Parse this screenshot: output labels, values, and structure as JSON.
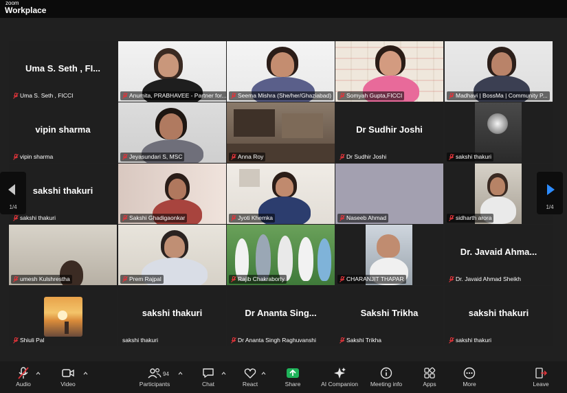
{
  "app": {
    "brand_small": "zoom",
    "brand_big": "Workplace"
  },
  "gallery": {
    "page_left": "1/4",
    "page_right": "1/4",
    "tiles": [
      {
        "big": "Uma S. Seth , FI...",
        "label": "Uma S. Seth , FICCI"
      },
      {
        "big": "",
        "label": "Anumita, PRABHAVEE - Partner for..."
      },
      {
        "big": "",
        "label": "Seema Mishra (She/her/Ghaziabad)"
      },
      {
        "big": "",
        "label": "Somyah Gupta,FICCI"
      },
      {
        "big": "",
        "label": "Madhavi | BossMa | Community P..."
      },
      {
        "big": "vipin sharma",
        "label": "vipin sharma"
      },
      {
        "big": "",
        "label": "Jeyasundari S, MSC"
      },
      {
        "big": "",
        "label": "Anna Roy"
      },
      {
        "big": "Dr Sudhir Joshi",
        "label": "Dr Sudhir Joshi"
      },
      {
        "big": "",
        "label": "sakshi thakuri"
      },
      {
        "big": "sakshi thakuri",
        "label": "sakshi thakuri"
      },
      {
        "big": "",
        "label": "Sakshi Ghadigaonkar"
      },
      {
        "big": "",
        "label": "Jyoti Khemka"
      },
      {
        "big": "",
        "label": "Naseeb Ahmad"
      },
      {
        "big": "",
        "label": "sidharth arora"
      },
      {
        "big": "",
        "label": "umesh Kulshrestha"
      },
      {
        "big": "",
        "label": "Prem Rajpal"
      },
      {
        "big": "",
        "label": "Rajib Chakraborty"
      },
      {
        "big": "",
        "label": "CHARANJIT THAPAR"
      },
      {
        "big": "Dr. Javaid Ahma...",
        "label": "Dr. Javaid Ahmad Sheikh"
      },
      {
        "big": "",
        "label": "Shiuli Pal"
      },
      {
        "big": "sakshi thakuri",
        "label": "sakshi thakuri"
      },
      {
        "big": "Dr Ananta Sing...",
        "label": "Dr Ananta Singh Raghuvanshi"
      },
      {
        "big": "Sakshi Trikha",
        "label": "Sakshi Trikha"
      },
      {
        "big": "sakshi thakuri",
        "label": "sakshi thakuri"
      }
    ]
  },
  "toolbar": {
    "audio": "Audio",
    "video": "Video",
    "participants": "Participants",
    "participants_count": "94",
    "chat": "Chat",
    "react": "React",
    "share": "Share",
    "ai_companion": "AI Companion",
    "meeting_info": "Meeting info",
    "apps": "Apps",
    "more": "More",
    "leave": "Leave"
  },
  "colors": {
    "share_green": "#1fb35a",
    "active_speaker": "#2ecc71",
    "mute_red": "#e0343a",
    "nav_arrow": "#2d8cff"
  }
}
